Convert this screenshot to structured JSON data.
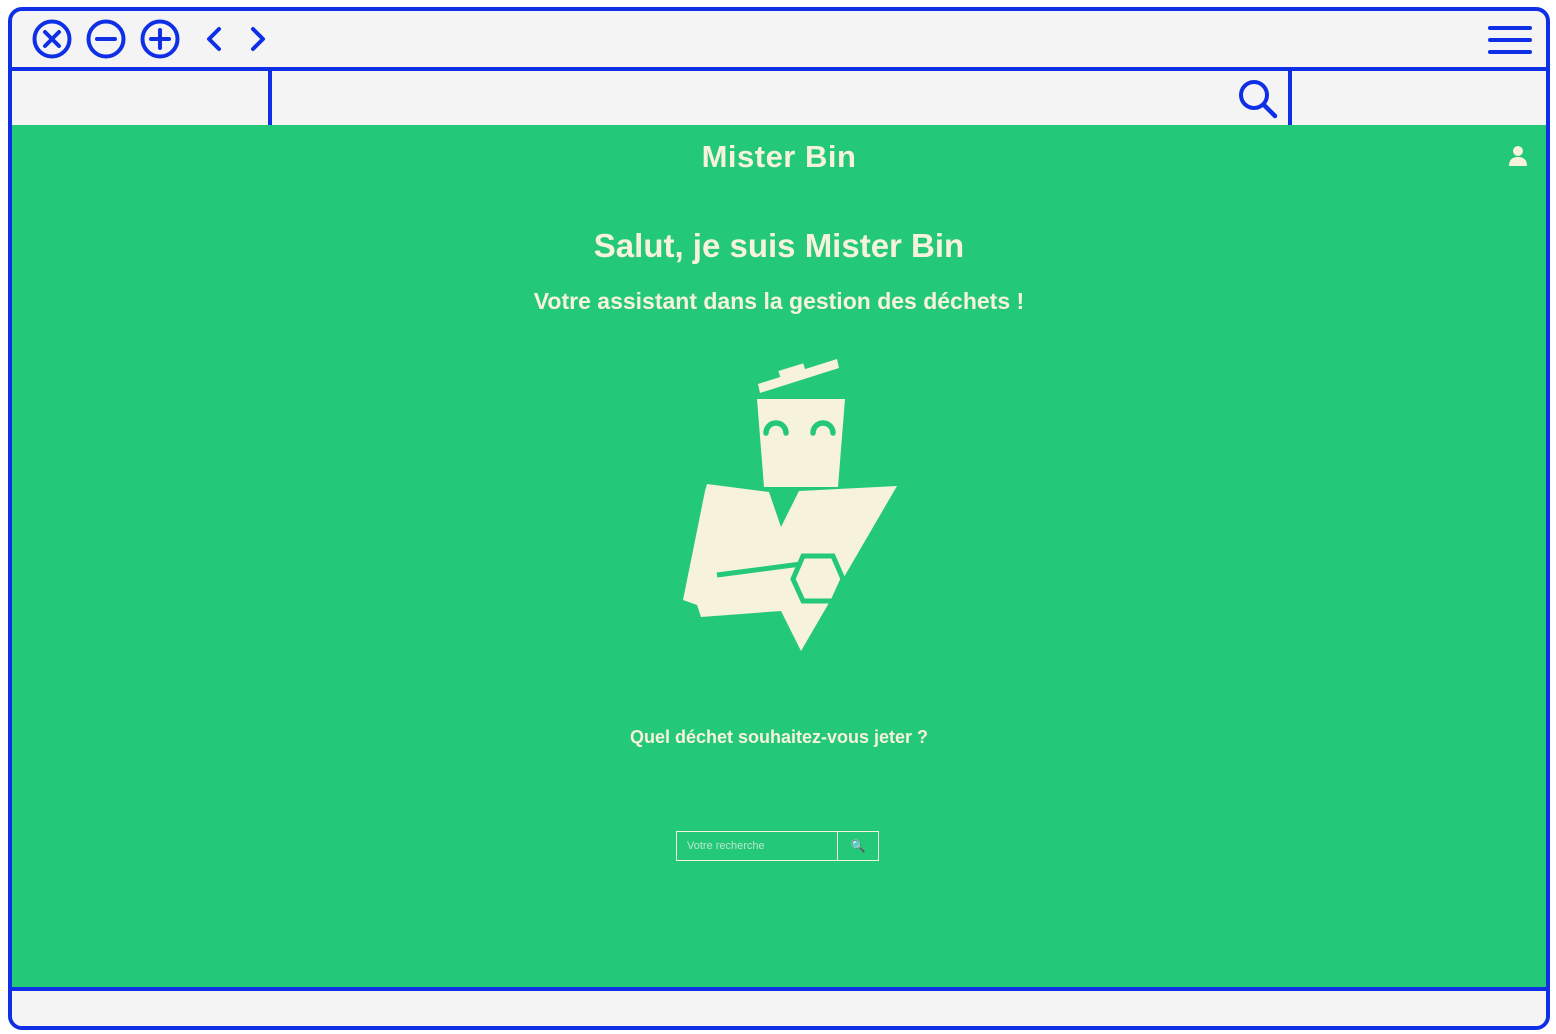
{
  "browser": {
    "controls": [
      "close",
      "minimize",
      "maximize",
      "back",
      "forward"
    ],
    "accent_color": "#0f2fe6"
  },
  "page": {
    "background_color": "#23c878",
    "text_color": "#f7f2dc",
    "brand": "Mister Bin",
    "headline": "Salut, je suis Mister Bin",
    "subtitle": "Votre assistant dans la gestion des déchets !",
    "question": "Quel déchet souhaitez-vous jeter ?",
    "search": {
      "placeholder": "Votre recherche",
      "value": "",
      "button_icon": "🔍"
    },
    "icons": [
      "user-icon",
      "mascot-bin-illustration"
    ]
  }
}
